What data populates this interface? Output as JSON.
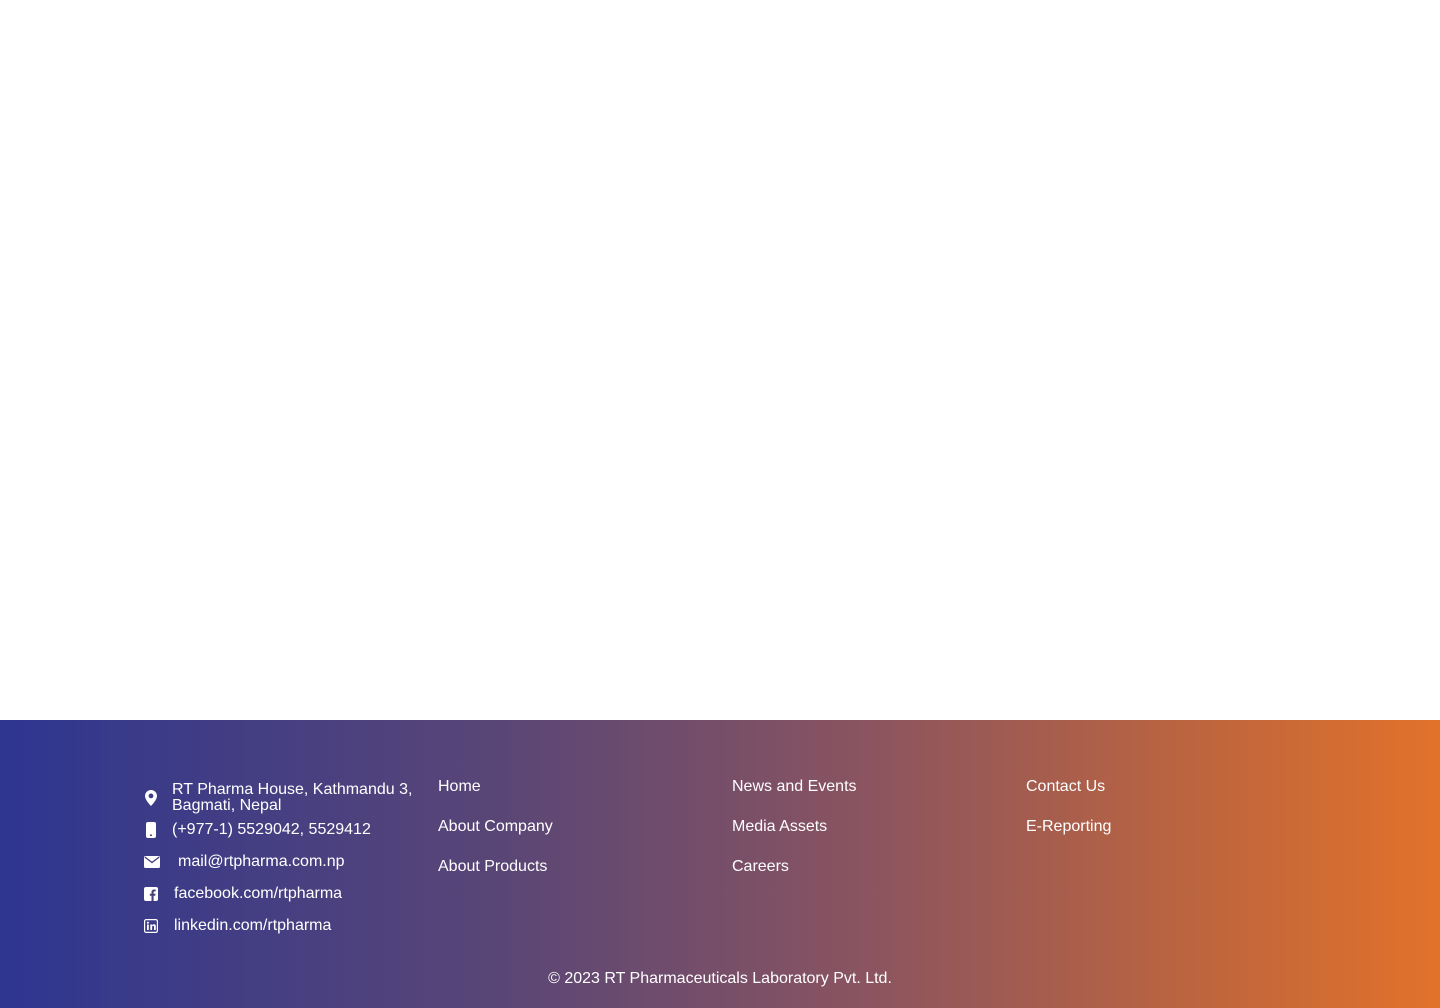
{
  "footer": {
    "contact": {
      "address": "RT Pharma House, Kathmandu 3, Bagmati, Nepal",
      "phone": "(+977-1) 5529042, 5529412",
      "email": "mail@rtpharma.com.np",
      "facebook": "facebook.com/rtpharma",
      "linkedin": "linkedin.com/rtpharma"
    },
    "links_col1": [
      "Home",
      "About Company",
      "About Products"
    ],
    "links_col2": [
      "News and Events",
      "Media Assets",
      "Careers"
    ],
    "links_col3": [
      "Contact Us",
      "E-Reporting"
    ],
    "copyright": "© 2023 RT Pharmaceuticals Laboratory Pvt. Ltd.",
    "gradient_colors": [
      "#2e3690",
      "#e2722a"
    ]
  },
  "icons": {
    "address": "map-pin-icon",
    "phone": "mobile-phone-icon",
    "email": "envelope-icon",
    "facebook": "facebook-icon",
    "linkedin": "linkedin-icon"
  }
}
